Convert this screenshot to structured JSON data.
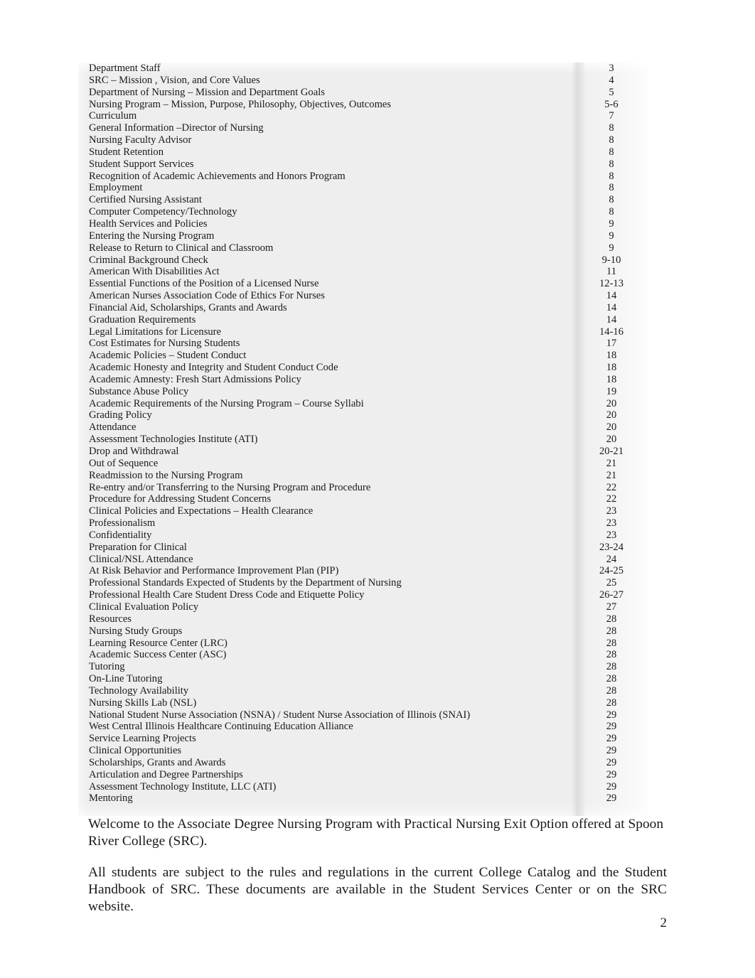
{
  "document": {
    "toc": {
      "entries": [
        {
          "title": "Department Staff",
          "page": "3"
        },
        {
          "title": "SRC – Mission , Vision, and  Core Values",
          "page": "4"
        },
        {
          "title": "Department of Nursing – Mission and Department Goals",
          "page": "5"
        },
        {
          "title": "Nursing Program – Mission, Purpose, Philosophy, Objectives, Outcomes",
          "page": "5-6"
        },
        {
          "title": "Curriculum",
          "page": "7"
        },
        {
          "title": "General Information –Director of Nursing",
          "page": "8"
        },
        {
          "title": "Nursing Faculty Advisor",
          "page": "8"
        },
        {
          "title": "Student Retention",
          "page": "8"
        },
        {
          "title": "Student Support Services",
          "page": "8"
        },
        {
          "title": "Recognition of Academic Achievements and Honors Program",
          "page": "8"
        },
        {
          "title": "Employment",
          "page": "8"
        },
        {
          "title": "Certified Nursing Assistant",
          "page": "8"
        },
        {
          "title": "Computer Competency/Technology",
          "page": "8"
        },
        {
          "title": "Health Services and Policies",
          "page": "9"
        },
        {
          "title": "Entering the Nursing Program",
          "page": "9"
        },
        {
          "title": "Release to Return to Clinical and Classroom",
          "page": "9"
        },
        {
          "title": "Criminal Background Check",
          "page": "9-10"
        },
        {
          "title": "American With Disabilities Act",
          "page": "11"
        },
        {
          "title": "Essential Functions of the Position of a Licensed Nurse",
          "page": "12-13"
        },
        {
          "title": "American Nurses Association Code of Ethics For Nurses",
          "page": "14"
        },
        {
          "title": "Financial Aid, Scholarships, Grants and Awards",
          "page": "14"
        },
        {
          "title": "Graduation Requirements",
          "page": "14"
        },
        {
          "title": "Legal Limitations for Licensure",
          "page": "14-16"
        },
        {
          "title": "Cost Estimates for Nursing Students",
          "page": "17"
        },
        {
          "title": "Academic Policies – Student Conduct",
          "page": "18"
        },
        {
          "title": "Academic Honesty and Integrity and Student Conduct Code",
          "page": "18"
        },
        {
          "title": "Academic Amnesty: Fresh Start Admissions Policy",
          "page": "18"
        },
        {
          "title": "Substance Abuse Policy",
          "page": "19"
        },
        {
          "title": "Academic Requirements of the Nursing Program – Course Syllabi",
          "page": "20"
        },
        {
          "title": "Grading Policy",
          "page": "20"
        },
        {
          "title": "Attendance",
          "page": "20"
        },
        {
          "title": "Assessment Technologies Institute (ATI)",
          "page": "20"
        },
        {
          "title": "Drop and Withdrawal",
          "page": "20-21"
        },
        {
          "title": "Out of Sequence",
          "page": "21"
        },
        {
          "title": "Readmission to the Nursing Program",
          "page": "21"
        },
        {
          "title": "Re-entry and/or Transferring  to the Nursing Program and Procedure",
          "page": "22"
        },
        {
          "title": "Procedure for Addressing Student Concerns",
          "page": "22"
        },
        {
          "title": "Clinical Policies and Expectations – Health Clearance",
          "page": "23"
        },
        {
          "title": "Professionalism",
          "page": "23"
        },
        {
          "title": "Confidentiality",
          "page": "23"
        },
        {
          "title": "Preparation for Clinical",
          "page": "23-24"
        },
        {
          "title": "Clinical/NSL Attendance",
          "page": "24"
        },
        {
          "title": "At Risk Behavior and Performance Improvement Plan (PIP)",
          "page": "24-25"
        },
        {
          "title": "Professional Standards Expected of Students by the Department of Nursing",
          "page": "25"
        },
        {
          "title": "Professional Health Care Student Dress Code and Etiquette Policy",
          "page": "26-27"
        },
        {
          "title": "Clinical Evaluation Policy",
          "page": "27"
        },
        {
          "title": "Resources",
          "page": "28"
        },
        {
          "title": "Nursing Study Groups",
          "page": "28"
        },
        {
          "title": "Learning Resource Center (LRC)",
          "page": "28"
        },
        {
          "title": "Academic Success Center (ASC)",
          "page": "28"
        },
        {
          "title": "Tutoring",
          "page": "28"
        },
        {
          "title": "On-Line Tutoring",
          "page": "28"
        },
        {
          "title": "Technology Availability",
          "page": "28"
        },
        {
          "title": "Nursing Skills Lab (NSL)",
          "page": "28"
        },
        {
          "title": "National Student Nurse Association (NSNA) / Student Nurse Association of Illinois (SNAI)",
          "page": "29"
        },
        {
          "title": "West Central Illinois Healthcare Continuing Education Alliance",
          "page": "29"
        },
        {
          "title": "Service Learning Projects",
          "page": "29"
        },
        {
          "title": "Clinical Opportunities",
          "page": "29"
        },
        {
          "title": "Scholarships, Grants and Awards",
          "page": "29"
        },
        {
          "title": "Articulation and Degree Partnerships",
          "page": "29"
        },
        {
          "title": "Assessment Technology Institute, LLC (ATI)",
          "page": "29"
        },
        {
          "title": "Mentoring",
          "page": "29"
        }
      ]
    },
    "body": {
      "paragraph_1": "Welcome to the Associate Degree Nursing Program with Practical Nursing Exit Option offered at Spoon River College (SRC).",
      "paragraph_2": "All students are subject to the rules and regulations in the current College Catalog and the Student Handbook of SRC.  These documents are available in the Student Services Center or on the SRC website."
    },
    "footer": {
      "page_number": "2"
    },
    "colors": {
      "page_background": "#ffffff",
      "toc_shading": "#eeeeee",
      "text": "#1a1a1a"
    }
  }
}
